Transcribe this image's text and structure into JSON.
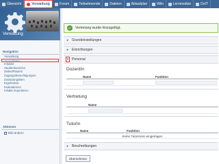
{
  "topnav": {
    "tabs": [
      {
        "label": "Übersicht",
        "icon": "overview-icon",
        "active": false
      },
      {
        "label": "Verwaltung",
        "icon": "settings-icon",
        "active": true
      },
      {
        "label": "Forum",
        "icon": "forum-icon",
        "active": false
      },
      {
        "label": "Teilnehmende",
        "icon": "participants-icon",
        "active": false
      },
      {
        "label": "Dateien",
        "icon": "files-icon",
        "active": false
      },
      {
        "label": "Ablaufplan",
        "icon": "schedule-icon",
        "active": false
      },
      {
        "label": "Wiki",
        "icon": "wiki-icon",
        "active": false
      },
      {
        "label": "Lernmodule",
        "icon": "learning-modules-icon",
        "active": false
      },
      {
        "label": "DoIT",
        "icon": "doit-icon",
        "active": false
      }
    ]
  },
  "sidebar": {
    "hero_title": "Verwaltung",
    "nav_heading": "Navigation",
    "nav_items": [
      {
        "label": "Verwaltung",
        "selected": false
      },
      {
        "label": "Grunddaten",
        "selected": true
      },
      {
        "label": "Infobild",
        "selected": false
      },
      {
        "label": "Studienbereiche",
        "selected": false
      },
      {
        "label": "Zeiten/Räume",
        "selected": false
      },
      {
        "label": "Zugangsberechtigungen",
        "selected": false
      },
      {
        "label": "Zusatzangaben",
        "selected": false
      },
      {
        "label": "Ergebnisse",
        "selected": false
      },
      {
        "label": "Evaluationen",
        "selected": false
      },
      {
        "label": "Inhalte importieren",
        "selected": false
      }
    ],
    "actions_heading": "Aktionen",
    "actions": [
      {
        "label": "Bild ändern",
        "icon": "image-edit-icon"
      }
    ]
  },
  "main": {
    "success_message": "Vertretung wurde hinzugefügt.",
    "sections": {
      "basic": "Grundeinstellungen",
      "institutions": "Einrichtungen",
      "staff": "Personal",
      "descriptions": "Beschreibungen"
    },
    "lecturers": {
      "heading": "DozentIn",
      "col_name": "Name",
      "col_function": "Funktion"
    },
    "deputies": {
      "heading": "Vertretung",
      "col_name": "Name"
    },
    "tutors": {
      "heading": "TutorIn",
      "col_name": "Name",
      "col_function": "Funktion",
      "empty": "Keine Tutorinnen eingetragen"
    },
    "save_button": "Übernehmen"
  },
  "colors": {
    "accent": "#3d6796",
    "highlight": "#dd3333",
    "success": "#55a03a"
  }
}
